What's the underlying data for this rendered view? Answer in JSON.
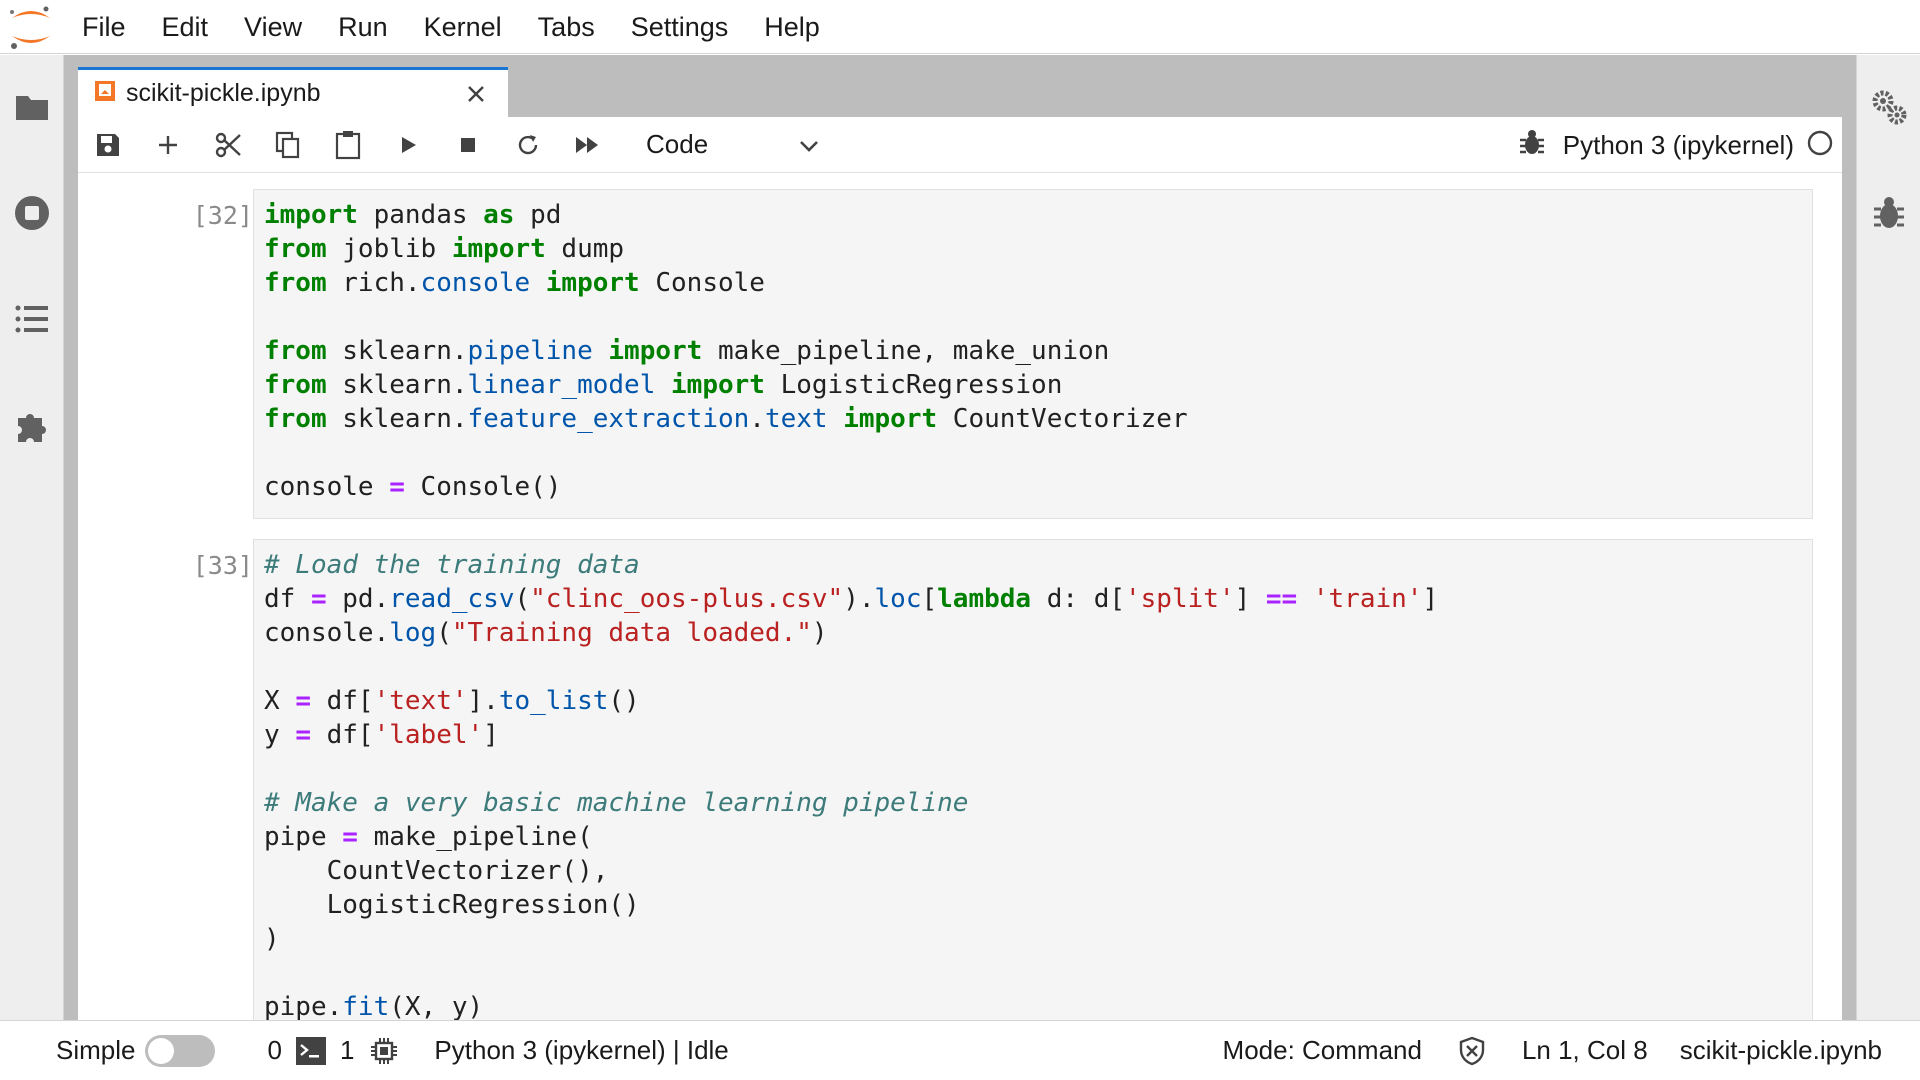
{
  "menu": [
    "File",
    "Edit",
    "View",
    "Run",
    "Kernel",
    "Tabs",
    "Settings",
    "Help"
  ],
  "tab": {
    "title": "scikit-pickle.ipynb"
  },
  "toolbar": {
    "cell_type": "Code",
    "kernel": "Python 3 (ipykernel)"
  },
  "cells": [
    {
      "prompt": "[32]:"
    },
    {
      "prompt": "[33]:"
    }
  ],
  "status": {
    "mode_label": "Simple",
    "terminals": "0",
    "kernels": "1",
    "kernel_status": "Python 3 (ipykernel) | Idle",
    "mode": "Mode: Command",
    "position": "Ln 1, Col 8",
    "file": "scikit-pickle.ipynb"
  },
  "code": {
    "c1": [
      [
        [
          "import",
          "kw"
        ],
        [
          " pandas ",
          ""
        ],
        [
          "as",
          "kw"
        ],
        [
          " pd",
          ""
        ]
      ],
      [
        [
          "from",
          "kw"
        ],
        [
          " joblib ",
          ""
        ],
        [
          "import",
          "kw"
        ],
        [
          " dump",
          ""
        ]
      ],
      [
        [
          "from",
          "kw"
        ],
        [
          " rich.",
          ""
        ],
        [
          "console",
          "mod"
        ],
        [
          " ",
          ""
        ],
        [
          "import",
          "kw"
        ],
        [
          " Console",
          ""
        ]
      ],
      [],
      [
        [
          "from",
          "kw"
        ],
        [
          " sklearn.",
          ""
        ],
        [
          "pipeline",
          "mod"
        ],
        [
          " ",
          ""
        ],
        [
          "import",
          "kw"
        ],
        [
          " make_pipeline, make_union",
          ""
        ]
      ],
      [
        [
          "from",
          "kw"
        ],
        [
          " sklearn.",
          ""
        ],
        [
          "linear_model",
          "mod"
        ],
        [
          " ",
          ""
        ],
        [
          "import",
          "kw"
        ],
        [
          " LogisticRegression",
          ""
        ]
      ],
      [
        [
          "from",
          "kw"
        ],
        [
          " sklearn.",
          ""
        ],
        [
          "feature_extraction",
          "mod"
        ],
        [
          ".",
          ""
        ],
        [
          "text",
          "mod"
        ],
        [
          " ",
          ""
        ],
        [
          "import",
          "kw"
        ],
        [
          " CountVectorizer",
          ""
        ]
      ],
      [],
      [
        [
          "console ",
          ""
        ],
        [
          "=",
          "op"
        ],
        [
          " Console()",
          ""
        ]
      ]
    ],
    "c2": [
      [
        [
          "# Load the training data",
          "cmt"
        ]
      ],
      [
        [
          "df ",
          ""
        ],
        [
          "=",
          "op"
        ],
        [
          " pd.",
          ""
        ],
        [
          "read_csv",
          "mod"
        ],
        [
          "(",
          ""
        ],
        [
          "\"clinc_oos-plus.csv\"",
          "str"
        ],
        [
          ").",
          ""
        ],
        [
          "loc",
          "mod"
        ],
        [
          "[",
          ""
        ],
        [
          "lambda",
          "kw"
        ],
        [
          " d: d[",
          ""
        ],
        [
          "'split'",
          "str"
        ],
        [
          "] ",
          ""
        ],
        [
          "==",
          "op"
        ],
        [
          " ",
          ""
        ],
        [
          "'train'",
          "str"
        ],
        [
          "]",
          ""
        ]
      ],
      [
        [
          "console.",
          ""
        ],
        [
          "log",
          "mod"
        ],
        [
          "(",
          ""
        ],
        [
          "\"Training data loaded.\"",
          "str"
        ],
        [
          ")",
          ""
        ]
      ],
      [],
      [
        [
          "X ",
          ""
        ],
        [
          "=",
          "op"
        ],
        [
          " df[",
          ""
        ],
        [
          "'text'",
          "str"
        ],
        [
          "].",
          ""
        ],
        [
          "to_list",
          "mod"
        ],
        [
          "()",
          ""
        ]
      ],
      [
        [
          "y ",
          ""
        ],
        [
          "=",
          "op"
        ],
        [
          " df[",
          ""
        ],
        [
          "'label'",
          "str"
        ],
        [
          "]",
          ""
        ]
      ],
      [],
      [
        [
          "# Make a very basic machine learning pipeline",
          "cmt"
        ]
      ],
      [
        [
          "pipe ",
          ""
        ],
        [
          "=",
          "op"
        ],
        [
          " make_pipeline(",
          ""
        ]
      ],
      [
        [
          "    CountVectorizer(),",
          ""
        ]
      ],
      [
        [
          "    LogisticRegression()",
          ""
        ]
      ],
      [
        [
          ")",
          ""
        ]
      ],
      [],
      [
        [
          "pipe.",
          ""
        ],
        [
          "fit",
          "mod"
        ],
        [
          "(X, y)",
          ""
        ]
      ]
    ]
  },
  "colors": {
    "accent": "#1976d2",
    "keyword": "#008000",
    "string": "#ba2121",
    "comment": "#3d7b7b",
    "operator": "#aa22ff",
    "module": "#0055aa",
    "logo": "#f37726"
  }
}
